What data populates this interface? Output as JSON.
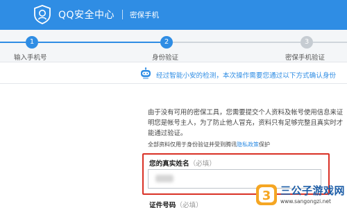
{
  "header": {
    "brand": "QQ安全中心",
    "subtitle": "密保手机",
    "color": "#2f8de4"
  },
  "steps": [
    {
      "number": "1",
      "label": "输入手机号",
      "status": "done"
    },
    {
      "number": "2",
      "label": "身份验证",
      "status": "current"
    },
    {
      "number": "3",
      "label": "密保手机验证",
      "status": "todo"
    }
  ],
  "notice": {
    "icon": "robot-icon",
    "text": "经过智能小安的检测，本次操作需要您通过以下方式确认身份"
  },
  "explanation": "由于没有可用的密保工具，您需要提交个人资料及帐号使用信息来证明您是帐号主人，为了防止他人冒充，资料只有足够完整且真实时才能通过验证。",
  "privacy": {
    "before": "全部资料仅用于身份验证并受到腾讯",
    "link": "隐私政策",
    "after": "保护"
  },
  "form": {
    "name_label": "您的真实姓名",
    "name_hint": "（必填）",
    "name_value": "",
    "id_label": "证件号码",
    "id_hint": "（必填）",
    "highlight_color": "#d93025"
  },
  "watermark": {
    "title": "三公子游戏网",
    "url": "www.sangongzi.net"
  }
}
